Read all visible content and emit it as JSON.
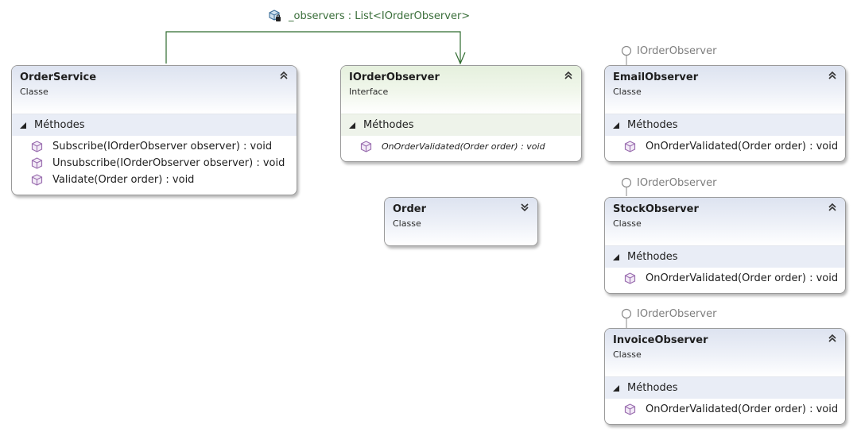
{
  "association": {
    "label": "_observers : List<IOrderObserver>",
    "icon": "field-private-icon",
    "color": "#2f6b2f"
  },
  "shapes": {
    "order_service": {
      "name": "OrderService",
      "kind": "Classe",
      "section": "Méthodes",
      "methods": [
        "Subscribe(IOrderObserver observer) : void",
        "Unsubscribe(IOrderObserver observer) : void",
        "Validate(Order order) : void"
      ]
    },
    "iorder_observer": {
      "name": "IOrderObserver",
      "kind": "Interface",
      "section": "Méthodes",
      "methods": [
        "OnOrderValidated(Order order) : void"
      ]
    },
    "order": {
      "name": "Order",
      "kind": "Classe"
    },
    "email_observer": {
      "name": "EmailObserver",
      "kind": "Classe",
      "section": "Méthodes",
      "lollipop": "IOrderObserver",
      "methods": [
        "OnOrderValidated(Order order) : void"
      ]
    },
    "stock_observer": {
      "name": "StockObserver",
      "kind": "Classe",
      "section": "Méthodes",
      "lollipop": "IOrderObserver",
      "methods": [
        "OnOrderValidated(Order order) : void"
      ]
    },
    "invoice_observer": {
      "name": "InvoiceObserver",
      "kind": "Classe",
      "section": "Méthodes",
      "lollipop": "IOrderObserver",
      "methods": [
        "OnOrderValidated(Order order) : void"
      ]
    }
  },
  "icons": {
    "collapse": "chevron-double-up-icon",
    "expand": "chevron-double-down-icon",
    "method": "method-cube-icon",
    "section": "section-expanded-triangle-icon"
  },
  "colors": {
    "class_header": "#dde3f0",
    "interface_header": "#e5f0dd",
    "association_line": "#2f6b2f",
    "method_icon": "#9b6fb0"
  }
}
